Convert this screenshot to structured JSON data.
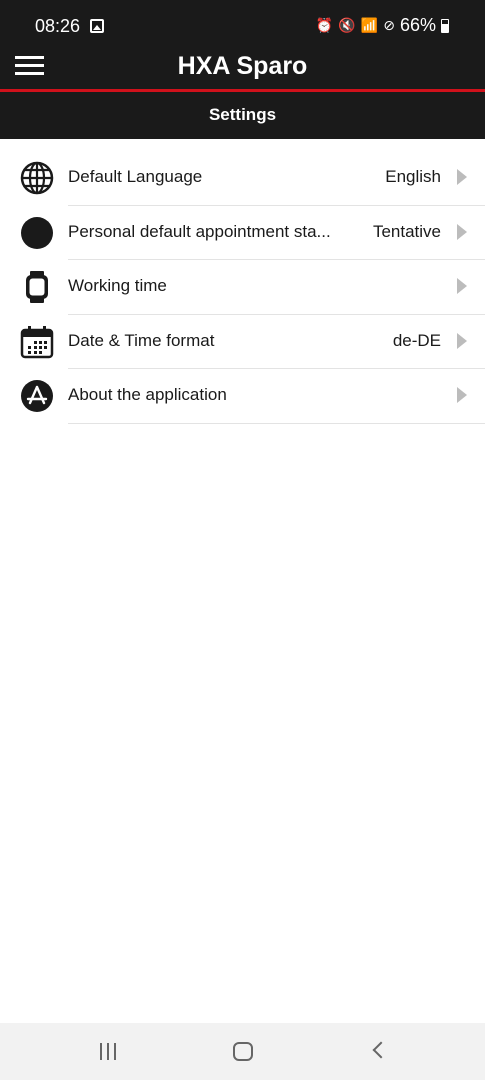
{
  "status_bar": {
    "time": "08:26",
    "battery": "66%",
    "icons": [
      "gallery-icon",
      "alarm-icon",
      "mute-icon",
      "wifi-icon",
      "dnd-icon",
      "battery-icon"
    ]
  },
  "app": {
    "title": "HXA Sparo",
    "page_title": "Settings",
    "accent_color": "#d0111b",
    "header_color": "#1a1a1a"
  },
  "settings": {
    "items": [
      {
        "icon": "globe-icon",
        "label": "Default Language",
        "value": "English"
      },
      {
        "icon": "circle-icon",
        "label": "Personal default appointment sta...",
        "value": "Tentative"
      },
      {
        "icon": "watch-icon",
        "label": "Working time",
        "value": ""
      },
      {
        "icon": "calendar-icon",
        "label": "Date & Time format",
        "value": "de-DE"
      },
      {
        "icon": "app-store-icon",
        "label": "About the application",
        "value": ""
      }
    ]
  },
  "nav_bar": {
    "icons": [
      "recents-icon",
      "home-icon",
      "back-icon"
    ]
  }
}
